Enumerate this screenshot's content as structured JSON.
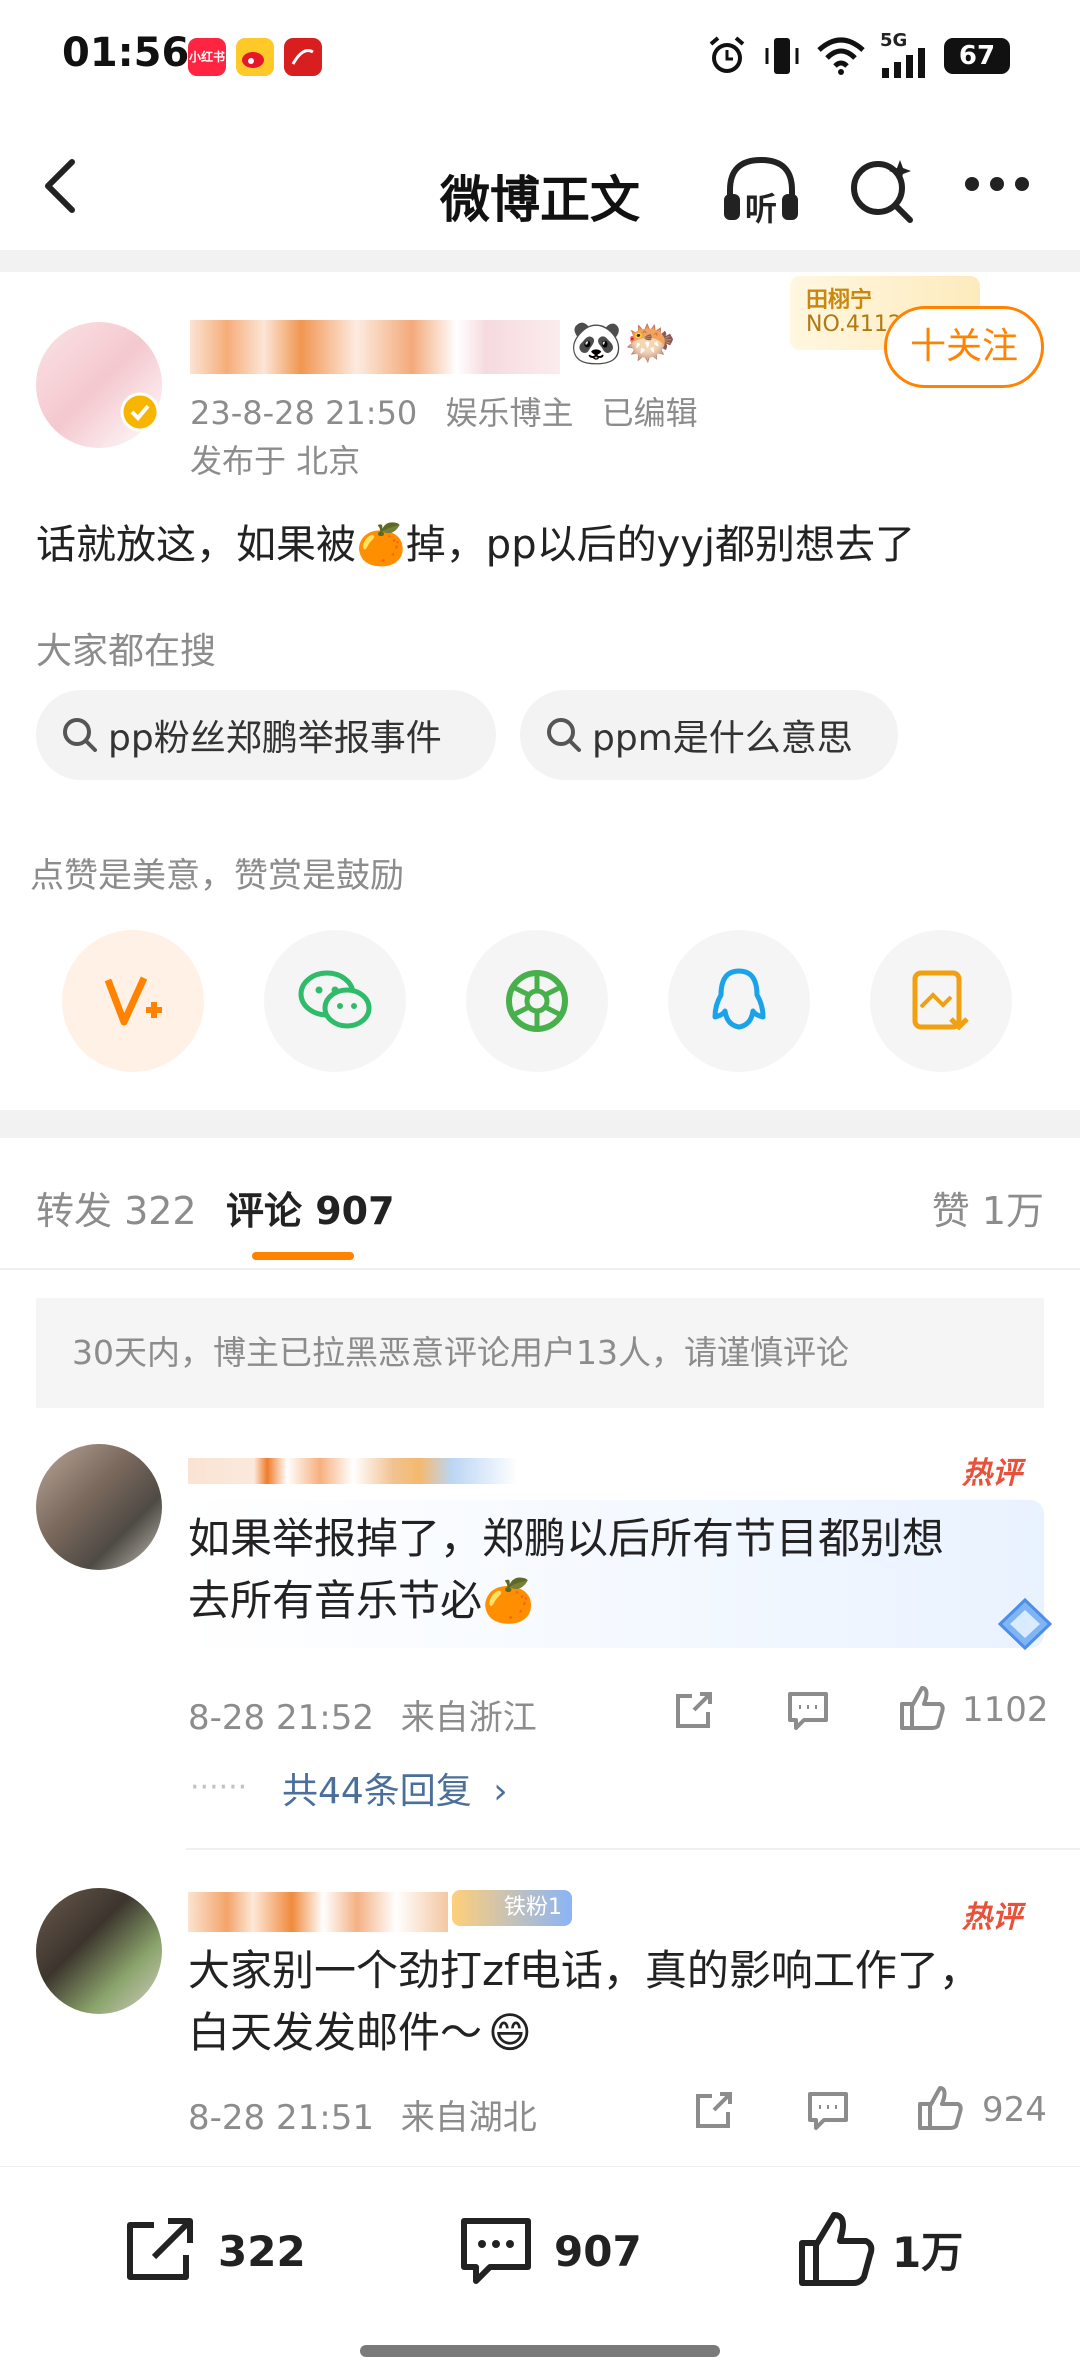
{
  "status_bar": {
    "time": "01:56",
    "app1_label": "小红书",
    "network": "5G",
    "battery": "67"
  },
  "nav": {
    "title": "微博正文",
    "listen_label": "听"
  },
  "post": {
    "badge_name": "田栩宁",
    "badge_no": "NO.4112",
    "follow_label": "十关注",
    "date": "23-8-28 21:50",
    "tag": "娱乐博主",
    "edited": "已编辑",
    "location": "发布于 北京",
    "text": "话就放这，如果被🍊掉，pp以后的yyj都别想去了",
    "search_title": "大家都在搜",
    "search_chips": [
      "pp粉丝郑鹏举报事件",
      "ppm是什么意思"
    ],
    "reward_tip": "点赞是美意，赞赏是鼓励"
  },
  "tabs": {
    "repost": "转发 322",
    "comment": "评论 907",
    "like": "赞 1万"
  },
  "notice": "30天内，博主已拉黑恶意评论用户13人，请谨慎评论",
  "comments": [
    {
      "hot_label": "热评",
      "text_line1": "如果举报掉了，郑鹏以后所有节目都别想",
      "text_line2": "去所有音乐节必🍊",
      "time": "8-28 21:52",
      "from": "来自浙江",
      "likes": "1102",
      "replies": "共44条回复"
    },
    {
      "hot_label": "热评",
      "fan_badge": "铁粉1",
      "text_line1": "大家别一个劲打zf电话，真的影响工作了，",
      "text_line2": "白天发发邮件～",
      "time": "8-28 21:51",
      "from": "来自湖北",
      "likes": "924"
    }
  ],
  "bottom_bar": {
    "repost": "322",
    "comment": "907",
    "like": "1万"
  },
  "colors": {
    "accent": "#ff8200",
    "link": "#4a6f9b",
    "hot": "#e8513a"
  }
}
